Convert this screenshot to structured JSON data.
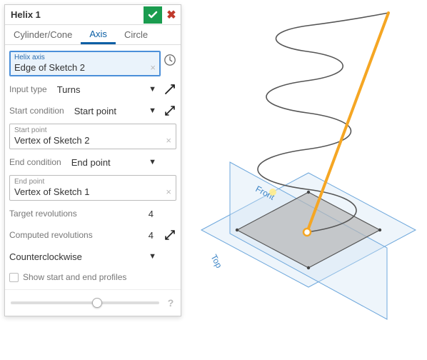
{
  "header": {
    "title": "Helix 1"
  },
  "tabs": {
    "a": "Cylinder/Cone",
    "b": "Axis",
    "c": "Circle"
  },
  "axisField": {
    "label": "Helix axis",
    "value": "Edge of Sketch 2"
  },
  "inputType": {
    "label": "Input type",
    "value": "Turns"
  },
  "startCond": {
    "label": "Start condition",
    "value": "Start point"
  },
  "startPoint": {
    "label": "Start point",
    "value": "Vertex of Sketch 2"
  },
  "endCond": {
    "label": "End condition",
    "value": "End point"
  },
  "endPoint": {
    "label": "End point",
    "value": "Vertex of Sketch 1"
  },
  "targetRev": {
    "label": "Target revolutions",
    "value": "4"
  },
  "compRev": {
    "label": "Computed revolutions",
    "value": "4"
  },
  "direction": {
    "value": "Counterclockwise"
  },
  "showProfiles": {
    "label": "Show start and end profiles"
  },
  "planes": {
    "front": "Front",
    "top": "Top"
  }
}
